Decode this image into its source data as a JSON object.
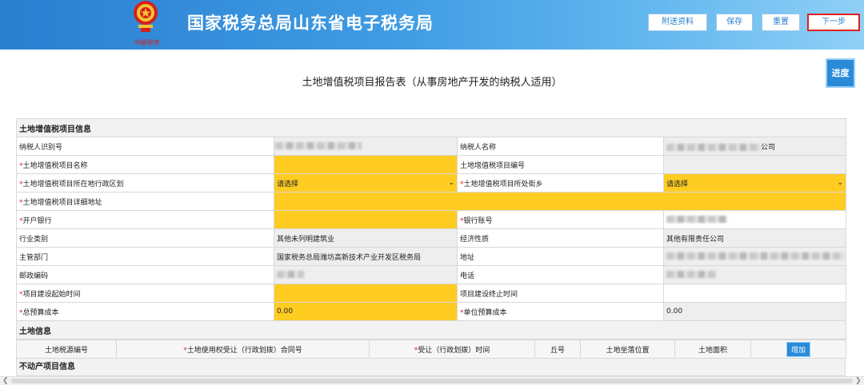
{
  "header": {
    "app_title": "国家税务总局山东省电子税务局",
    "emblem_caption": "中国税务",
    "buttons": {
      "attach": "附送资料",
      "save": "保存",
      "reset": "重置",
      "next": "下一步"
    },
    "colors": {
      "accent": "#2a7fd0",
      "next_border": "#e02020"
    }
  },
  "progress_button": "进度",
  "page_title": "土地增值税项目报告表（从事房地产开发的纳税人适用）",
  "project_info": {
    "section_title": "土地增值税项目信息",
    "taxpayer_id_label": "纳税人识别号",
    "taxpayer_name_label": "纳税人名称",
    "taxpayer_name_suffix": "公司",
    "project_name_label": "土地增值税项目名称",
    "project_no_label": "土地增值税项目编号",
    "district_label": "土地增值税项目所在地行政区划",
    "district_value": "请选择",
    "street_label": "土地增值税项目所处街乡",
    "street_value": "请选择",
    "address_detail_label": "土地增值税项目详细地址",
    "bank_label": "开户银行",
    "account_label": "银行账号",
    "industry_label": "行业类别",
    "industry_value": "其他未列明建筑业",
    "econ_label": "经济性质",
    "econ_value": "其他有限责任公司",
    "authority_label": "主管部门",
    "authority_value": "国家税务总局潍坊高新技术产业开发区税务局",
    "address_label": "地址",
    "postcode_label": "邮政编码",
    "phone_label": "电话",
    "start_label": "项目建设起始时间",
    "end_label": "项目建设终止时间",
    "budget_label": "总预算成本",
    "budget_value": "0.00",
    "unit_budget_label": "单位预算成本",
    "unit_budget_value": "0.00"
  },
  "land_info": {
    "section_title": "土地信息",
    "columns": [
      "土地税源编号",
      "土地使用权受让（行政划拨）合同号",
      "受让（行政划拨）时间",
      "丘号",
      "土地坐落位置",
      "土地面积"
    ],
    "add_button": "增加"
  },
  "property_info": {
    "section_title": "不动产项目信息"
  }
}
